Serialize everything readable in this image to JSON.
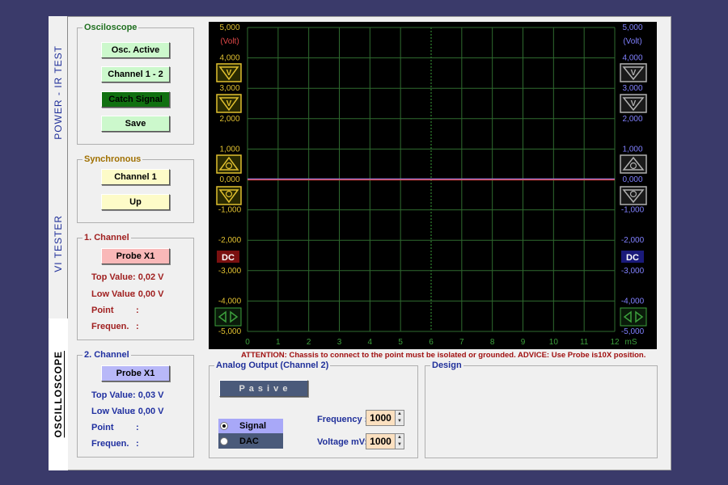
{
  "tabs": [
    {
      "label": "POWER - IR TEST"
    },
    {
      "label": "VI TESTER"
    },
    {
      "label": "OSCILLOSCOPE"
    }
  ],
  "oscilloscope": {
    "title": "Osciloscope",
    "buttons": [
      "Osc. Active",
      "Channel  1 - 2",
      "Catch Signal",
      "Save"
    ]
  },
  "synchronous": {
    "title": "Synchronous",
    "channel": "Channel 1",
    "edge": "Up"
  },
  "channel1": {
    "title": "1. Channel",
    "probe": "Probe X1",
    "top_label": "Top Value",
    "top_value": ": 0,02 V",
    "low_label": "Low Value",
    "low_value": ": 0,00 V",
    "point_label": "Point",
    "point_value": ":",
    "freq_label": "Frequen.",
    "freq_value": ":"
  },
  "channel2": {
    "title": "2. Channel",
    "probe": "Probe X1",
    "top_label": "Top Value",
    "top_value": ": 0,03 V",
    "low_label": "Low Value",
    "low_value": ": 0,00 V",
    "point_label": "Point",
    "point_value": ":",
    "freq_label": "Frequen.",
    "freq_value": ":"
  },
  "scope": {
    "y_unit": "(Volt)",
    "x_unit": "mS",
    "y_ticks": [
      "5,000",
      "4,000",
      "3,000",
      "2,000",
      "1,000",
      "0,000",
      "-1,000",
      "-2,000",
      "-3,000",
      "-4,000",
      "-5,000"
    ],
    "x_ticks": [
      "0",
      "1",
      "2",
      "3",
      "4",
      "5",
      "6",
      "7",
      "8",
      "9",
      "10",
      "11",
      "12"
    ],
    "left_coupling": "DC",
    "right_coupling": "DC",
    "colors": {
      "ch1": "#e04848",
      "ch2": "#9a7ae0",
      "grid": "#2f6b2f",
      "center": "#3ca03c",
      "left_axis": "#e0c030",
      "right_axis": "#8080ff"
    }
  },
  "attention": "ATTENTION: Chassis to connect to the point must be isolated or grounded.  ADVICE: Use Probe is10X position.",
  "analog_output": {
    "title": "Analog Output  (Channel 2)",
    "state_button": "P a s i v e",
    "options": [
      "Signal",
      "DAC"
    ],
    "selected": "Signal",
    "frequency_label": "Frequency :",
    "frequency_value": "1000",
    "voltage_label": "Voltage mV:",
    "voltage_value": "1000"
  },
  "design": {
    "title": "Design"
  }
}
